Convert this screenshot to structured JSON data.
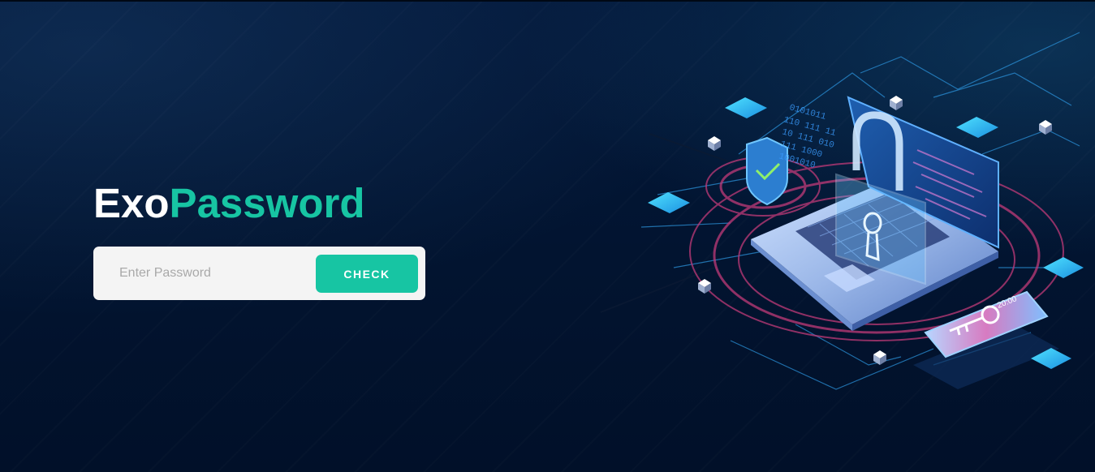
{
  "brand": {
    "part1": "Exo",
    "part2": "Password"
  },
  "form": {
    "placeholder": "Enter Password",
    "value": "",
    "button_label": "CHECK"
  },
  "colors": {
    "background": "#01132c",
    "accent": "#17c5a3",
    "input_bg": "#f4f4f4",
    "brand_white": "#ffffff"
  },
  "illustration": {
    "icons": [
      "laptop-icon",
      "padlock-icon",
      "shield-check-icon",
      "smartphone-key-icon",
      "binary-code-icon"
    ],
    "binary_text": "0101011 110 111 11 10 111 010 1000 1001010",
    "phone_text": "20:00"
  }
}
